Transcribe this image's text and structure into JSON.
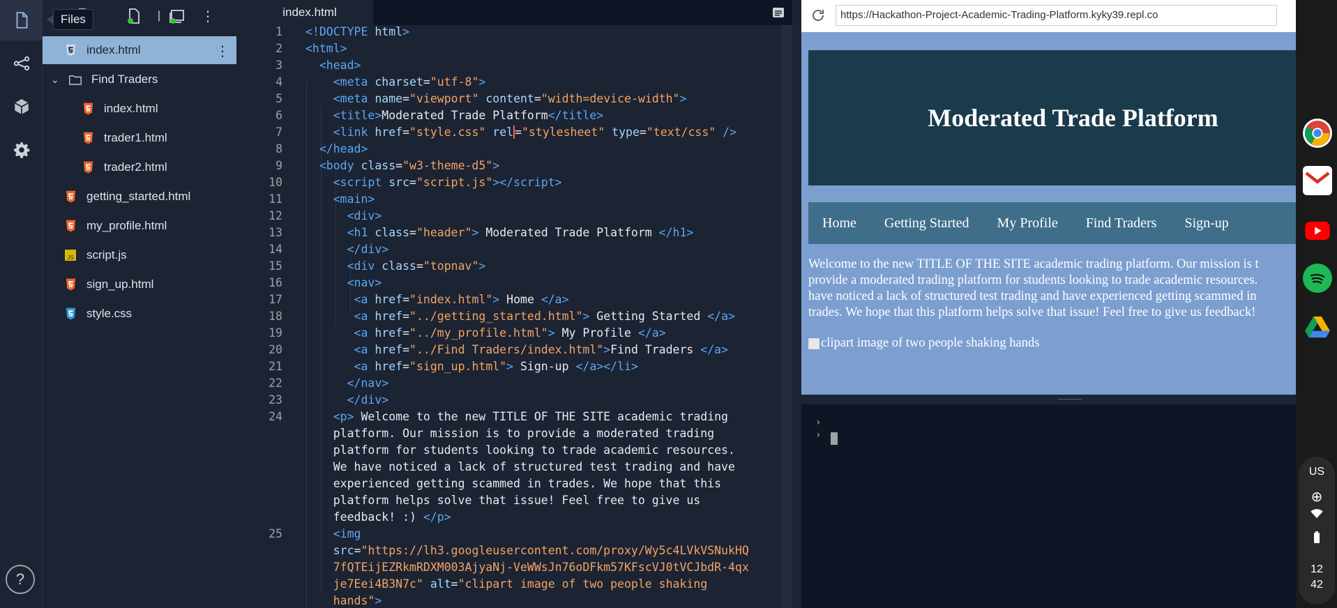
{
  "activity_bar": {
    "items": [
      "files-icon",
      "version-control-icon",
      "packages-icon",
      "settings-icon"
    ],
    "help_label": "?",
    "tooltip": "Files"
  },
  "file_tree": {
    "files": [
      {
        "name": "index.html",
        "type": "html5-blue",
        "selected": true,
        "indent": 0
      },
      {
        "name": "Find Traders",
        "type": "folder",
        "indent": 0
      },
      {
        "name": "index.html",
        "type": "html5",
        "indent": 1
      },
      {
        "name": "trader1.html",
        "type": "html5",
        "indent": 1
      },
      {
        "name": "trader2.html",
        "type": "html5",
        "indent": 1
      },
      {
        "name": "getting_started.html",
        "type": "html5",
        "indent": 0
      },
      {
        "name": "my_profile.html",
        "type": "html5",
        "indent": 0
      },
      {
        "name": "script.js",
        "type": "js",
        "indent": 0
      },
      {
        "name": "sign_up.html",
        "type": "html5",
        "indent": 0
      },
      {
        "name": "style.css",
        "type": "css3",
        "indent": 0
      }
    ]
  },
  "editor": {
    "tab_label": "index.html",
    "line_numbers": [
      "1",
      "2",
      "3",
      "4",
      "5",
      "6",
      "7",
      "8",
      "9",
      "10",
      "11",
      "12",
      "13",
      "14",
      "15",
      "16",
      "17",
      "18",
      "19",
      "20",
      "21",
      "22",
      "23",
      "24",
      "",
      "",
      "",
      "",
      "",
      "",
      "25",
      "",
      "",
      "",
      "",
      ""
    ]
  },
  "preview": {
    "url": "https://Hackathon-Project-Academic-Trading-Platform.kyky39.repl.co",
    "heading": "Moderated Trade Platform",
    "nav": [
      "Home",
      "Getting Started",
      "My Profile",
      "Find Traders",
      "Sign-up"
    ],
    "paragraph_lines": [
      "Welcome to the new TITLE OF THE SITE academic trading platform. Our mission is t",
      "provide a moderated trading platform for students looking to trade academic resources.",
      "have noticed a lack of structured test trading and have experienced getting scammed in",
      "trades. We hope that this platform helps solve that issue! Feel free to give us feedback!"
    ],
    "image_alt": "clipart image of two people shaking hands"
  },
  "shelf": {
    "keyboard": "US",
    "time_hour": "12",
    "time_min": "42",
    "apps": [
      "chrome-icon",
      "gmail-icon",
      "youtube-icon",
      "spotify-icon",
      "drive-icon"
    ]
  },
  "colors": {
    "editor_bg": "#1c2333",
    "tag": "#5ba8f5",
    "attr": "#a5d8ff",
    "string": "#f4a462",
    "selected_file": "#8fb3d6",
    "preview_bg": "#7c9fd0",
    "hero_bg": "#1b3b4c",
    "nav_bg": "#3f6e8a"
  }
}
